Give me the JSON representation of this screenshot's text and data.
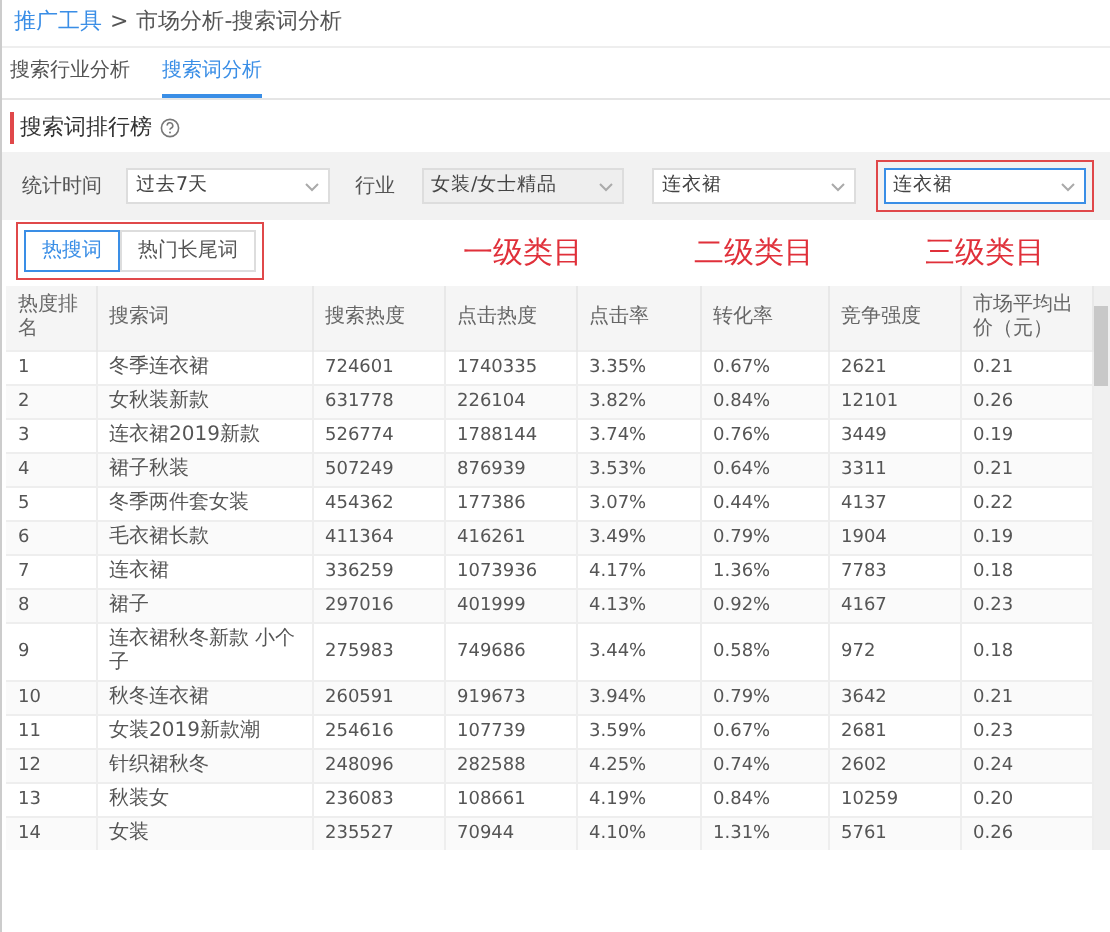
{
  "breadcrumb": {
    "link": "推广工具",
    "separator": ">",
    "current": "市场分析-搜索词分析"
  },
  "tabs": [
    {
      "label": "搜索行业分析",
      "selected": false
    },
    {
      "label": "搜索词分析",
      "selected": true
    }
  ],
  "section_title": "搜索词排行榜",
  "filters": [
    {
      "label": "统计时间",
      "value": "过去7天",
      "disabled": false,
      "focused": false,
      "outlined": false
    },
    {
      "label": "行业",
      "value": "女装/女士精品",
      "disabled": true,
      "focused": false,
      "outlined": false
    },
    {
      "value": "连衣裙",
      "disabled": false,
      "focused": false,
      "outlined": false
    },
    {
      "value": "连衣裙",
      "disabled": false,
      "focused": true,
      "outlined": true
    }
  ],
  "annotations": [
    "一级类目",
    "二级类目",
    "三级类目"
  ],
  "keyword_tabs": {
    "outlined": true,
    "items": [
      {
        "label": "热搜词",
        "selected": true
      },
      {
        "label": "热门长尾词",
        "selected": false
      }
    ]
  },
  "table": {
    "columns": [
      "热度排名",
      "搜索词",
      "搜索热度",
      "点击热度",
      "点击率",
      "转化率",
      "竞争强度",
      "市场平均出价（元）"
    ],
    "rows": [
      [
        "1",
        "冬季连衣裙",
        "724601",
        "1740335",
        "3.35%",
        "0.67%",
        "2621",
        "0.21"
      ],
      [
        "2",
        "女秋装新款",
        "631778",
        "226104",
        "3.82%",
        "0.84%",
        "12101",
        "0.26"
      ],
      [
        "3",
        "连衣裙2019新款",
        "526774",
        "1788144",
        "3.74%",
        "0.76%",
        "3449",
        "0.19"
      ],
      [
        "4",
        "裙子秋装",
        "507249",
        "876939",
        "3.53%",
        "0.64%",
        "3311",
        "0.21"
      ],
      [
        "5",
        "冬季两件套女装",
        "454362",
        "177386",
        "3.07%",
        "0.44%",
        "4137",
        "0.22"
      ],
      [
        "6",
        "毛衣裙长款",
        "411364",
        "416261",
        "3.49%",
        "0.79%",
        "1904",
        "0.19"
      ],
      [
        "7",
        "连衣裙",
        "336259",
        "1073936",
        "4.17%",
        "1.36%",
        "7783",
        "0.18"
      ],
      [
        "8",
        "裙子",
        "297016",
        "401999",
        "4.13%",
        "0.92%",
        "4167",
        "0.23"
      ],
      [
        "9",
        "连衣裙秋冬新款 小个子",
        "275983",
        "749686",
        "3.44%",
        "0.58%",
        "972",
        "0.18"
      ],
      [
        "10",
        "秋冬连衣裙",
        "260591",
        "919673",
        "3.94%",
        "0.79%",
        "3642",
        "0.21"
      ],
      [
        "11",
        "女装2019新款潮",
        "254616",
        "107739",
        "3.59%",
        "0.67%",
        "2681",
        "0.23"
      ],
      [
        "12",
        "针织裙秋冬",
        "248096",
        "282588",
        "4.25%",
        "0.74%",
        "2602",
        "0.24"
      ],
      [
        "13",
        "秋装女",
        "236083",
        "108661",
        "4.19%",
        "0.84%",
        "10259",
        "0.20"
      ],
      [
        "14",
        "女装",
        "235527",
        "70944",
        "4.10%",
        "1.31%",
        "5761",
        "0.26"
      ]
    ]
  }
}
